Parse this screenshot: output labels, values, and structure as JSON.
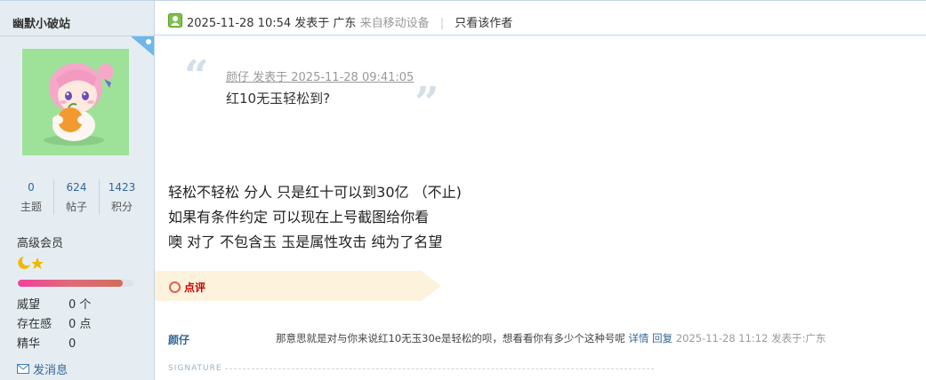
{
  "sidebar": {
    "author_name": "幽默小破站",
    "stats": [
      {
        "value": "0",
        "label": "主题"
      },
      {
        "value": "624",
        "label": "帖子"
      },
      {
        "value": "1423",
        "label": "积分"
      }
    ],
    "group": "高级会员",
    "credit_progress": 0.91,
    "attributes": [
      {
        "key": "威望",
        "value": "0 个"
      },
      {
        "key": "存在感",
        "value": "0 点"
      },
      {
        "key": "精华",
        "value": "0"
      }
    ],
    "send_message": "发消息",
    "colors": {
      "background": "#e5edf2",
      "border": "#c2d5e3",
      "progress": "#f0429a"
    }
  },
  "header": {
    "datetime": "2025-11-28 10:54",
    "posted_at": "发表于 广东",
    "device": "来自移动设备",
    "only_author": "只看该作者"
  },
  "quote": {
    "meta": "颜仔 发表于 2025-11-28 09:41:05",
    "text": "红10无玉轻松到?"
  },
  "message": {
    "lines": [
      "轻松不轻松 分人 只是红十可以到30亿  （不止)",
      "如果有条件约定 可以现在上号截图给你看",
      "噢 对了 不包含玉 玉是属性攻击 纯为了名望"
    ]
  },
  "comments": {
    "title": "点评",
    "items": [
      {
        "author": "颜仔",
        "text": "那意思就是对与你来说红10无玉30e是轻松的呗，想看看你有多少个这种号呢",
        "detail": "详情",
        "reply": "回复",
        "time": "2025-11-28 11:12 发表于:广东"
      }
    ]
  },
  "signature_label": "SIGNATURE"
}
